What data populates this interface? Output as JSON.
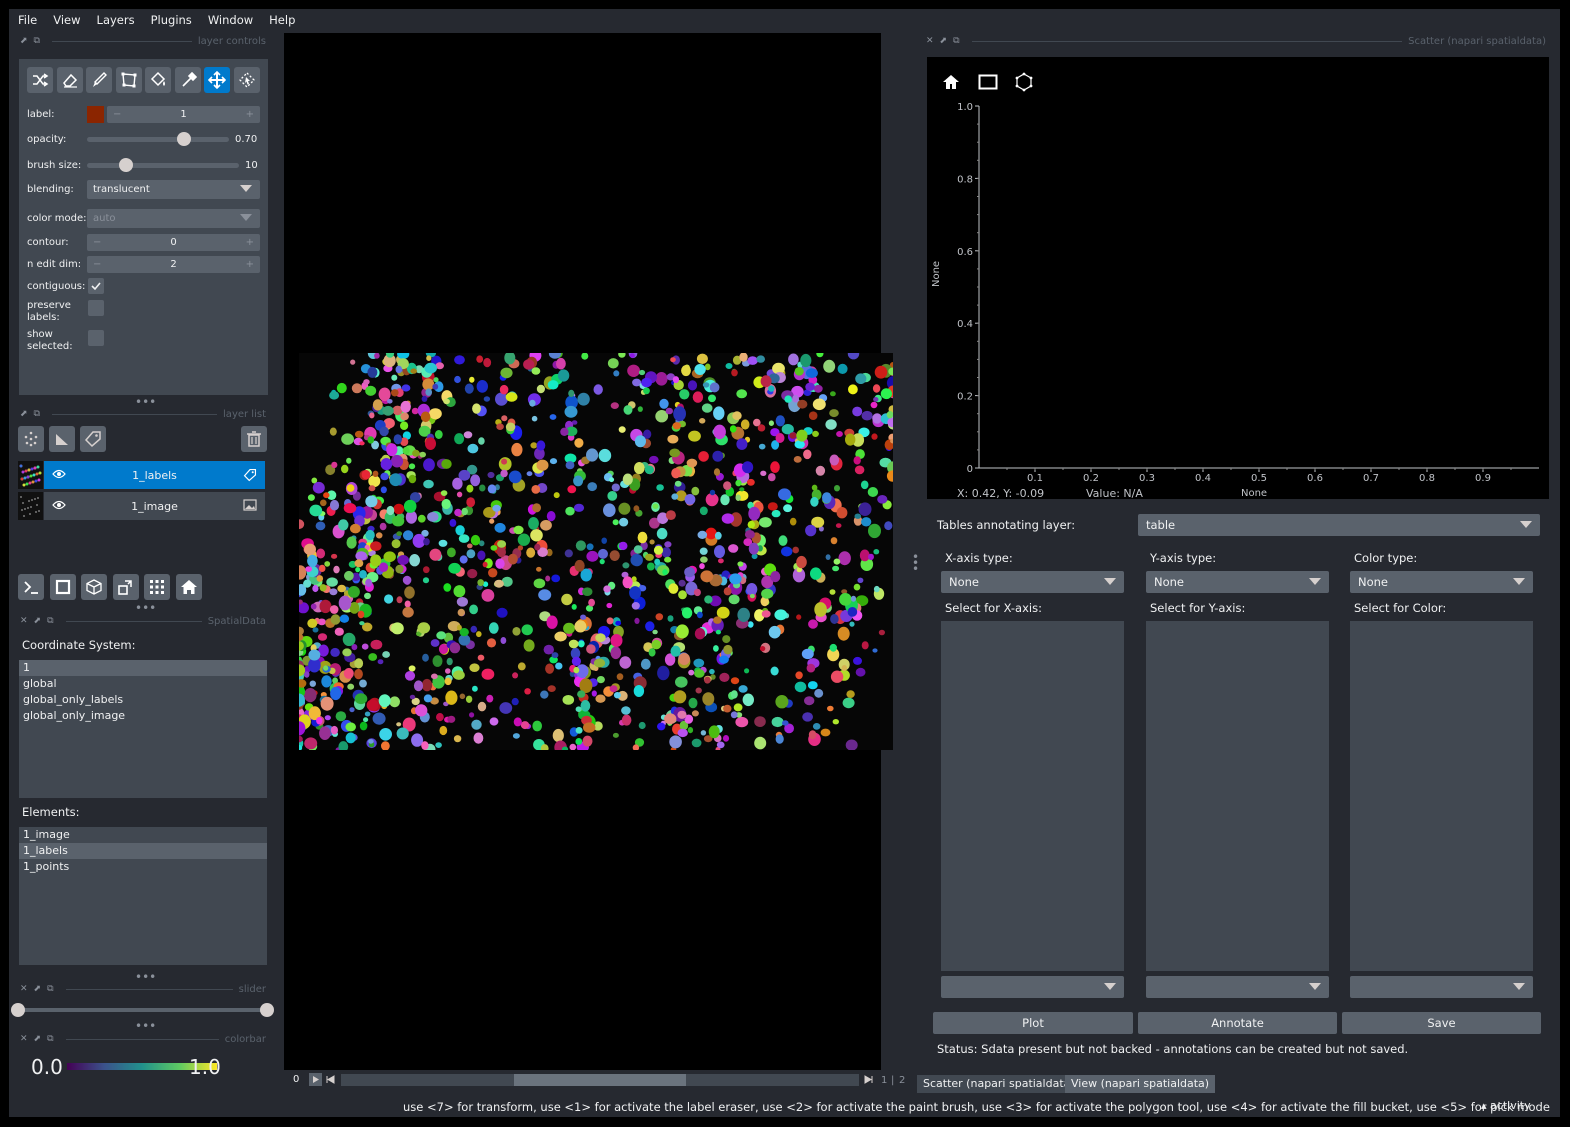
{
  "menu": [
    "File",
    "View",
    "Layers",
    "Plugins",
    "Window",
    "Help"
  ],
  "docks": {
    "layer_controls": "layer controls",
    "layer_list": "layer list",
    "spatialdata": "SpatialData",
    "slider": "slider",
    "colorbar": "colorbar",
    "scatter": "Scatter (napari spatialdata)"
  },
  "layer_controls": {
    "tools": [
      "shuffle-icon",
      "eraser-icon",
      "paint-brush-icon",
      "polygon-icon",
      "fill-bucket-icon",
      "color-picker-icon",
      "transform-icon",
      "pan-zoom-icon"
    ],
    "active_tool": 6,
    "label_label": "label:",
    "label_value": "1",
    "label_color": "#8b2500",
    "opacity_label": "opacity:",
    "opacity_value": "0.70",
    "opacity_fraction": 0.7,
    "brush_label": "brush size:",
    "brush_value": "10",
    "brush_fraction": 0.25,
    "blending_label": "blending:",
    "blending_value": "translucent",
    "color_mode_label": "color mode:",
    "color_mode_value": "auto",
    "contour_label": "contour:",
    "contour_value": "0",
    "n_edit_label": "n edit dim:",
    "n_edit_value": "2",
    "contiguous_label": "contiguous:",
    "contiguous_checked": true,
    "preserve_label_1": "preserve",
    "preserve_label_2": "labels:",
    "show_label_1": "show",
    "show_label_2": "selected:"
  },
  "layer_list": {
    "layers": [
      {
        "name": "1_labels",
        "selected": true,
        "visible": true,
        "type_icon": "label-icon"
      },
      {
        "name": "1_image",
        "selected": false,
        "visible": true,
        "type_icon": "image-icon"
      }
    ]
  },
  "spatialdata": {
    "coord_title": "Coordinate System:",
    "coords": [
      "1",
      "global",
      "global_only_labels",
      "global_only_image"
    ],
    "coords_selected": 0,
    "elements_title": "Elements:",
    "elements": [
      "1_image",
      "1_labels",
      "1_points"
    ],
    "elements_selected": 1
  },
  "colorbar": {
    "min": "0.0",
    "max": "1.0"
  },
  "dims": {
    "start": "0",
    "current": "1",
    "total": "2"
  },
  "scatter": {
    "ylabel": "None",
    "xlabel": "None",
    "coords_readout": "X: 0.42, Y: -0.09",
    "value_readout": "Value: N/A",
    "tables_label": "Tables annotating layer:",
    "tables_value": "table",
    "x_type_label": "X-axis type:",
    "y_type_label": "Y-axis type:",
    "color_type_label": "Color type:",
    "x_type_value": "None",
    "y_type_value": "None",
    "color_type_value": "None",
    "x_select_label": "Select for X-axis:",
    "y_select_label": "Select for Y-axis:",
    "color_select_label": "Select for Color:",
    "plot_button": "Plot",
    "annotate_button": "Annotate",
    "save_button": "Save",
    "status": "Status: Sdata present but not backed - annotations can be created but not saved."
  },
  "tabs": [
    "Scatter (napari spatialdata)",
    "View (napari spatialdata)"
  ],
  "status_bar": "use <7> for transform, use <1> for activate the label eraser, use <2> for activate the paint brush, use <3> for activate the polygon tool, use <4> for activate the fill bucket, use <5> for pick mode",
  "activity": "activity",
  "chart_data": {
    "type": "scatter",
    "x": [],
    "y": [],
    "xlabel": "None",
    "ylabel": "None",
    "xlim": [
      0,
      1
    ],
    "ylim": [
      0,
      1
    ],
    "xticks": [
      "0.1",
      "0.2",
      "0.3",
      "0.4",
      "0.5",
      "0.6",
      "0.7",
      "0.8",
      "0.9"
    ],
    "yticks": [
      "0",
      "0.2",
      "0.4",
      "0.6",
      "0.8",
      "1.0"
    ]
  }
}
